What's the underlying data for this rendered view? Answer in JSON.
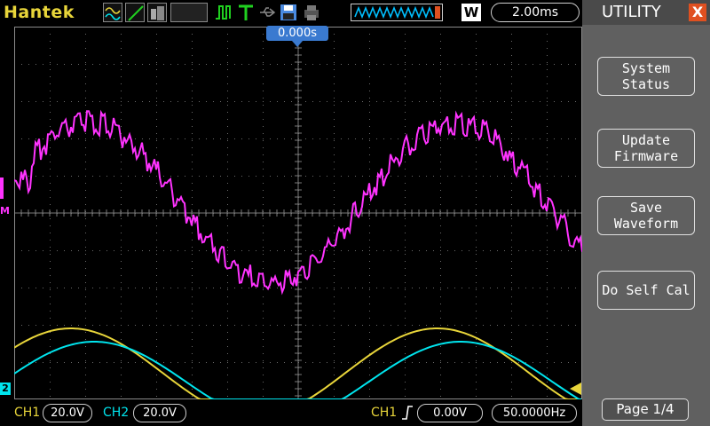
{
  "topbar": {
    "brand": "Hantek",
    "mode": "W",
    "timebase": "2.00ms"
  },
  "trigger_position": "0.000s",
  "markers": {
    "math": "M",
    "ch2": "2"
  },
  "bottombar": {
    "ch1_label": "CH1",
    "ch1_volts": "20.0V",
    "ch2_label": "CH2",
    "ch2_volts": "20.0V",
    "trig_source": "CH1",
    "trig_level": "0.00V",
    "trig_freq": "50.0000Hz"
  },
  "panel": {
    "title": "UTILITY",
    "close": "X",
    "buttons": [
      {
        "line1": "System",
        "line2": "Status"
      },
      {
        "line1": "Update",
        "line2": "Firmware"
      },
      {
        "line1": "Save",
        "line2": "Waveform"
      },
      {
        "line1": "Do Self Cal",
        "line2": ""
      }
    ],
    "page": "Page 1/4"
  },
  "colors": {
    "ch1": "#e8d53a",
    "ch2": "#00e5ee",
    "math": "#ff33ff",
    "panel": "#606060",
    "accent": "#3a7ad0"
  }
}
